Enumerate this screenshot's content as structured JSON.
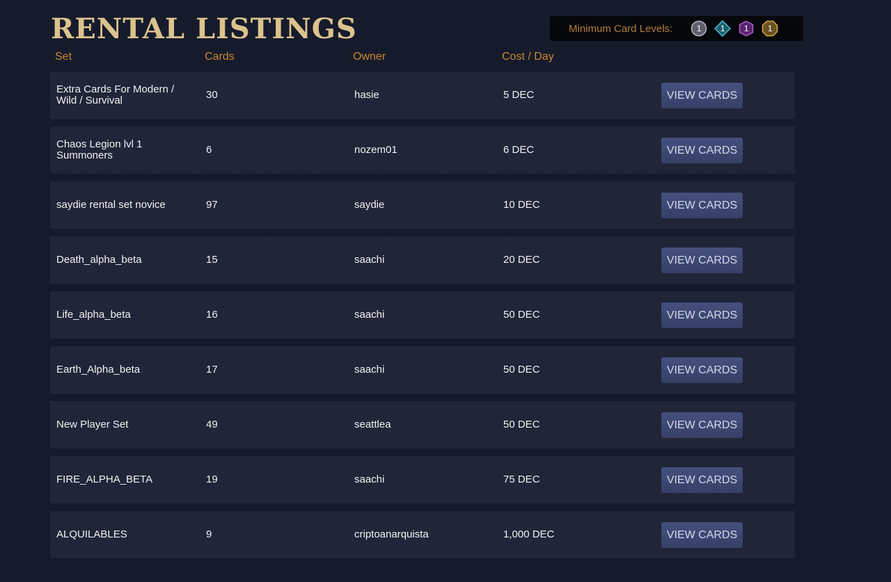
{
  "page": {
    "title": "RENTAL LISTINGS"
  },
  "levels": {
    "label": "Minimum Card Levels:",
    "items": [
      {
        "value": "1",
        "icon": "common-rarity-icon",
        "color": "#6b6e78"
      },
      {
        "value": "1",
        "icon": "rare-rarity-icon",
        "color": "#3fa3b5"
      },
      {
        "value": "1",
        "icon": "epic-rarity-icon",
        "color": "#8e3fa3"
      },
      {
        "value": "1",
        "icon": "legendary-rarity-icon",
        "color": "#c79a3a"
      }
    ]
  },
  "table": {
    "headers": {
      "set": "Set",
      "cards": "Cards",
      "owner": "Owner",
      "cost": "Cost / Day"
    },
    "button_label": "VIEW CARDS",
    "rows": [
      {
        "set": "Extra Cards For Modern / Wild / Survival",
        "cards": "30",
        "owner": "hasie",
        "cost": "5 DEC"
      },
      {
        "set": "Chaos Legion lvl 1 Summoners",
        "cards": "6",
        "owner": "nozem01",
        "cost": "6 DEC"
      },
      {
        "set": "saydie rental set novice",
        "cards": "97",
        "owner": "saydie",
        "cost": "10 DEC"
      },
      {
        "set": "Death_alpha_beta",
        "cards": "15",
        "owner": "saachi",
        "cost": "20 DEC"
      },
      {
        "set": "Life_alpha_beta",
        "cards": "16",
        "owner": "saachi",
        "cost": "50 DEC"
      },
      {
        "set": "Earth_Alpha_beta",
        "cards": "17",
        "owner": "saachi",
        "cost": "50 DEC"
      },
      {
        "set": "New Player Set",
        "cards": "49",
        "owner": "seattlea",
        "cost": "50 DEC"
      },
      {
        "set": "FIRE_ALPHA_BETA",
        "cards": "19",
        "owner": "saachi",
        "cost": "75 DEC"
      },
      {
        "set": "ALQUILABLES",
        "cards": "9",
        "owner": "criptoanarquista",
        "cost": "1,000 DEC"
      }
    ]
  }
}
